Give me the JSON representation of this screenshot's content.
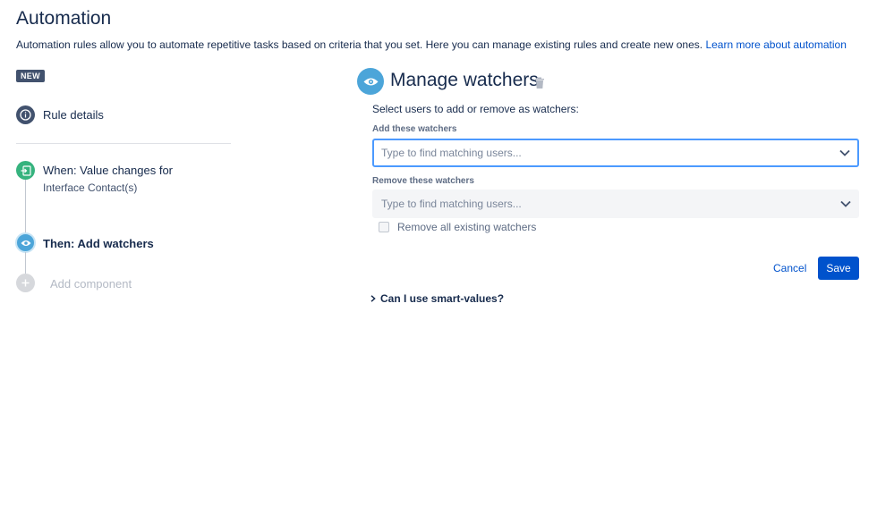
{
  "header": {
    "title": "Automation",
    "intro": "Automation rules allow you to automate repetitive tasks based on criteria that you set. Here you can manage existing rules and create new ones.",
    "learn_more": "Learn more about automation"
  },
  "steps": {
    "badge": "NEW",
    "rule_details": "Rule details",
    "trigger": {
      "label": "When: Value changes for",
      "sub": "Interface Contact(s)"
    },
    "action": "Then: Add watchers",
    "add_component": "Add component"
  },
  "panel": {
    "title": "Manage watchers",
    "instructions": "Select users to add or remove as watchers:",
    "add_label": "Add these watchers",
    "add_placeholder": "Type to find matching users...",
    "remove_label": "Remove these watchers",
    "remove_placeholder": "Type to find matching users...",
    "remove_all": "Remove all existing watchers",
    "cancel": "Cancel",
    "save": "Save",
    "smart_values": "Can I use smart-values?"
  },
  "colors": {
    "accent": "#0052cc",
    "focus_border": "#4c9aff",
    "trigger_green": "#36b37e",
    "action_blue": "#4ca5d9"
  },
  "icons": {
    "rule_details": "info-icon",
    "trigger": "trigger-icon",
    "action": "eye-icon",
    "add": "plus-icon",
    "delete": "trash-icon",
    "dropdown": "chevron-down-icon",
    "expand": "chevron-right-icon"
  }
}
